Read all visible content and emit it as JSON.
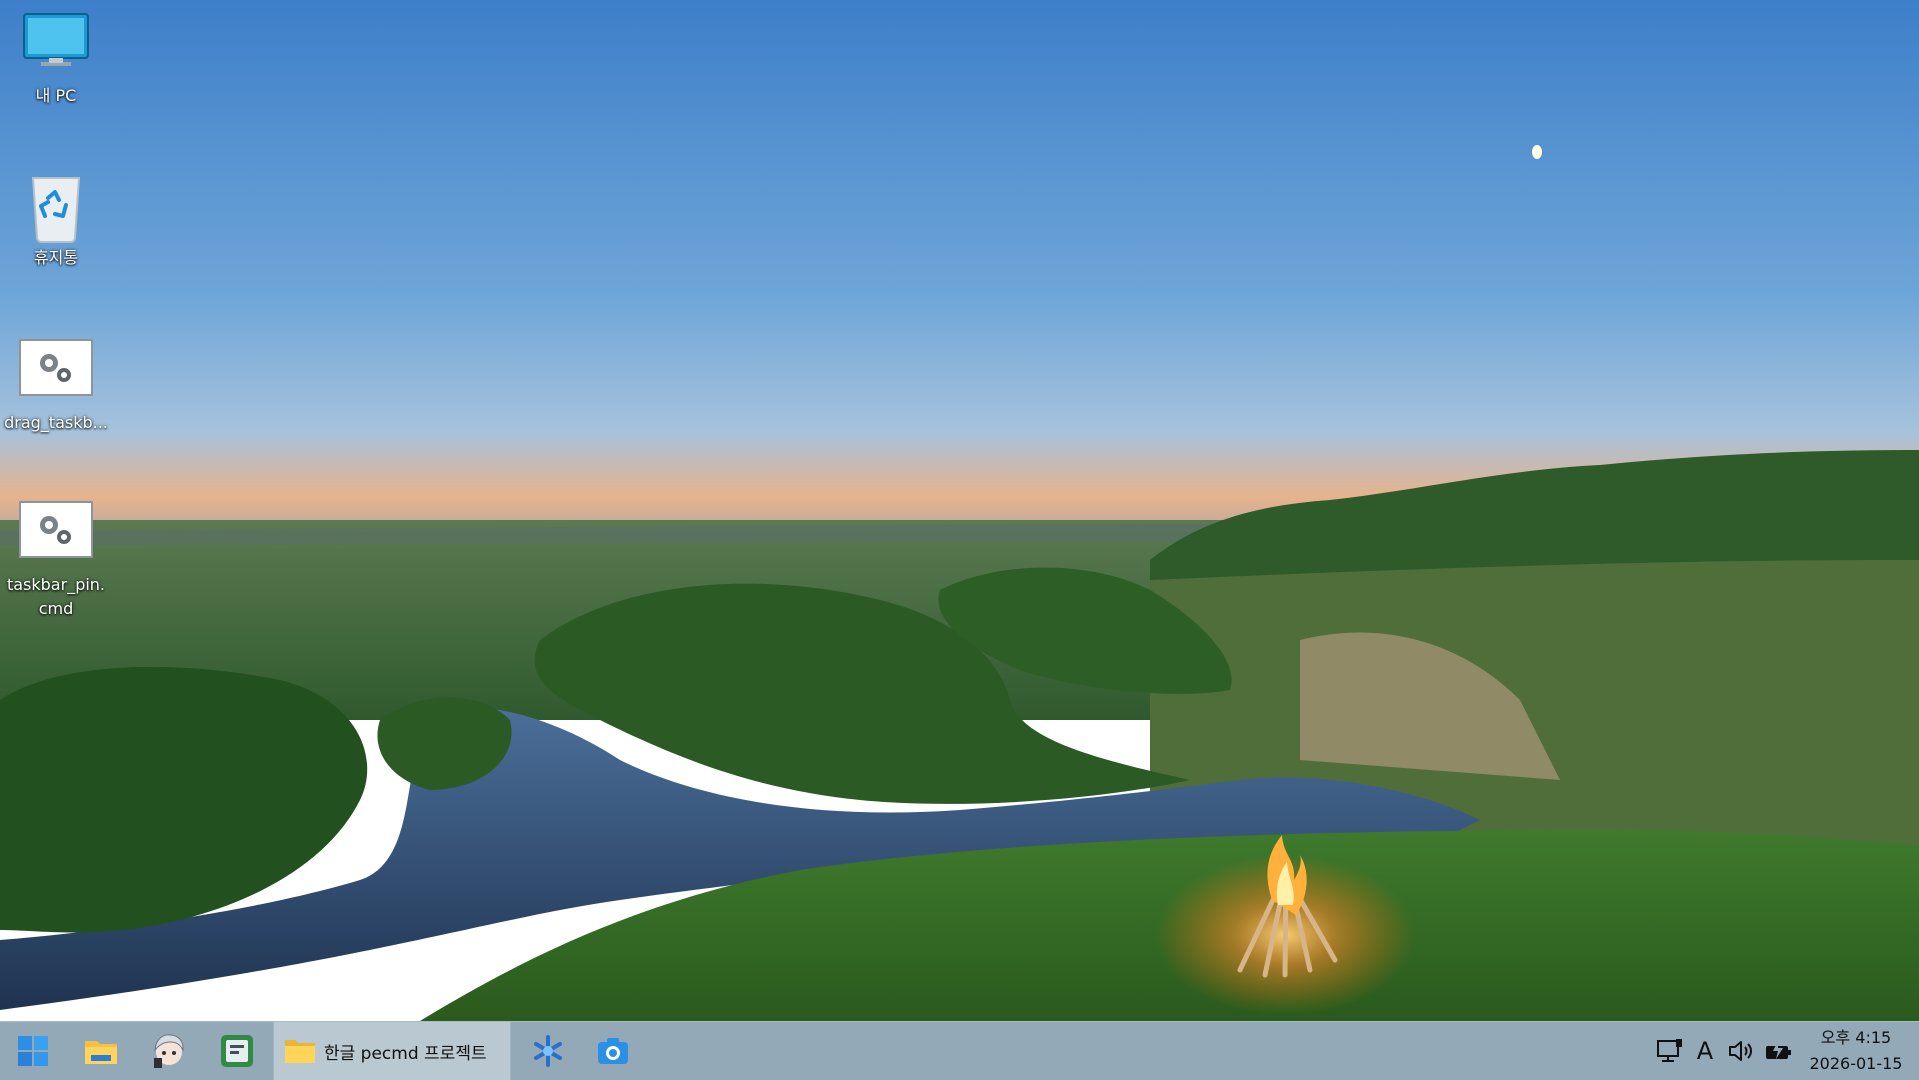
{
  "desktop": {
    "icons": [
      {
        "label": "내 PC",
        "icon": "monitor-icon"
      },
      {
        "label": "휴지통",
        "icon": "recycle-bin-icon"
      },
      {
        "label": "drag_taskb...",
        "icon": "gear-file-icon"
      },
      {
        "label": "taskbar_pin.cmd",
        "icon": "gear-file-icon"
      }
    ]
  },
  "taskbar": {
    "start": "windows-start-icon",
    "pinned": [
      "file-explorer-icon",
      "anime-avatar-app-icon",
      "terminal-app-icon"
    ],
    "active_window": {
      "label": "한글 pecmd 프로젝트",
      "icon": "folder-icon"
    },
    "pinned_after": [
      "snowflake-app-icon",
      "camera-app-icon"
    ],
    "tray": {
      "network": "network-icon",
      "ime": "A",
      "volume": "volume-icon",
      "battery": "battery-icon"
    },
    "clock": {
      "time": "오후 4:15",
      "date": "2026-01-15"
    }
  },
  "colors": {
    "taskbar_bg": "#93a9b7",
    "active_window_bg": "#b9c8d1"
  }
}
